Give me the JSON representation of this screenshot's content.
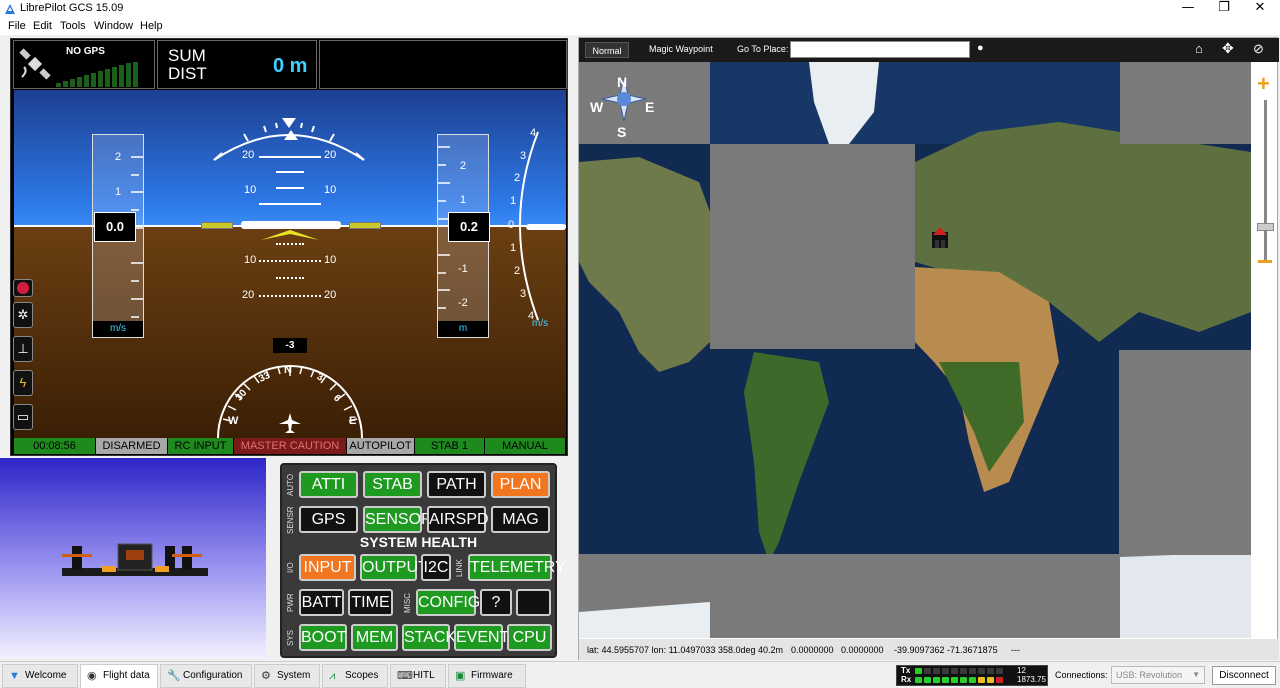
{
  "app": {
    "title": "LibrePilot GCS 15.09"
  },
  "window_controls": {
    "minimize": "—",
    "maximize": "❐",
    "close": "✕"
  },
  "menu": [
    "File",
    "Edit",
    "Tools",
    "Window",
    "Help"
  ],
  "pfd": {
    "gps_status": "NO GPS",
    "sum_dist_label1": "SUM",
    "sum_dist_label2": "DIST",
    "sum_dist_value": "0 m",
    "pitch_labels": [
      "20",
      "10",
      "10",
      "20"
    ],
    "speed_readout": "0.0",
    "speed_ticks": [
      "2",
      "1"
    ],
    "speed_unit": "m/s",
    "alt_readout": "0.2",
    "alt_ticks": [
      "2",
      "1",
      "-1",
      "-2"
    ],
    "alt_unit": "m",
    "vs_ticks": [
      "4",
      "3",
      "2",
      "1",
      "0",
      "1",
      "2",
      "3",
      "4"
    ],
    "vs_unit": "m/s",
    "heading_readout": "-3",
    "compass_labels": [
      "N",
      "33",
      "3",
      "30",
      "6",
      "W",
      "E"
    ],
    "status": {
      "time": "00:08:56",
      "armed": "DISARMED",
      "rc": "RC INPUT",
      "caution": "MASTER CAUTION",
      "autopilot": "AUTOPILOT",
      "stab": "STAB 1",
      "mode": "MANUAL"
    }
  },
  "health": {
    "title": "SYSTEM HEALTH",
    "groups": {
      "auto": "AUTO",
      "sensr": "SENSR",
      "io": "I/O",
      "link": "LINK",
      "pwr": "PWR",
      "misc": "MISC",
      "sys": "SYS"
    },
    "auto": [
      "ATTI",
      "STAB",
      "PATH",
      "PLAN"
    ],
    "sensr": [
      "GPS",
      "SENSOR",
      "AIRSPD",
      "MAG"
    ],
    "io": [
      "INPUT",
      "OUTPUT",
      "I2C"
    ],
    "link": [
      "TELEMETRY"
    ],
    "pwr": [
      "BATT",
      "TIME"
    ],
    "misc": [
      "CONFIG",
      "?",
      ""
    ],
    "sys": [
      "BOOT",
      "MEM",
      "STACK",
      "EVENT",
      "CPU"
    ]
  },
  "map": {
    "tool_normal": "Normal",
    "tool_magic": "Magic Waypoint",
    "goto_label": "Go To Place:",
    "goto_value": "",
    "compass": {
      "n": "N",
      "s": "S",
      "e": "E",
      "w": "W"
    },
    "status_coords": "lat: 44.5955707 lon: 11.0497033 358.0deg 40.2m",
    "status_a": "0.0000000",
    "status_b": "0.0000000",
    "status_c": "-39.9097362 -71.3671875",
    "status_d": "---",
    "zoom_level": 0.82
  },
  "tabs": [
    "Welcome",
    "Flight data",
    "Configuration",
    "System",
    "Scopes",
    "HITL",
    "Firmware"
  ],
  "bottom": {
    "tx": "Tx",
    "rx": "Rx",
    "tx_value": "12",
    "rx_value": "1873.75",
    "connections_label": "Connections:",
    "connection_value": "USB: Revolution",
    "disconnect": "Disconnect"
  }
}
